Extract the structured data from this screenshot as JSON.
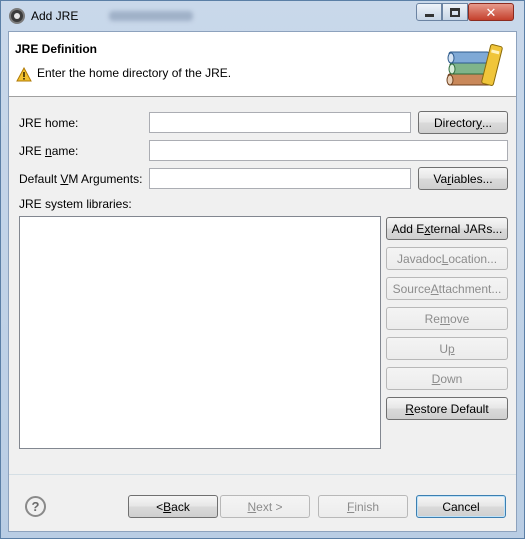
{
  "window": {
    "title": "Add JRE",
    "controls": {
      "minimize": "minimize-icon",
      "maximize": "maximize-icon",
      "close": "close-icon"
    }
  },
  "header": {
    "title": "JRE Definition",
    "message": "Enter the home directory of the JRE.",
    "message_icon": "warning-icon",
    "image": "jre-books-icon"
  },
  "form": {
    "jre_home": {
      "label_pre": "JRE home:",
      "value": ""
    },
    "jre_name": {
      "label_pre": "JRE ",
      "label_u": "n",
      "label_post": "ame:",
      "value": ""
    },
    "vm_args": {
      "label_pre": "Default ",
      "label_u": "V",
      "label_post": "M Arguments:",
      "value": ""
    },
    "directory_button": {
      "pre": "Director",
      "u": "y",
      "post": "..."
    },
    "variables_button": {
      "pre": "Va",
      "u": "r",
      "post": "iables..."
    },
    "libraries_label": "JRE system libraries:"
  },
  "side_buttons": {
    "add_external_jars": {
      "pre": "Add E",
      "u": "x",
      "post": "ternal JARs..."
    },
    "javadoc_location": {
      "pre": "Javadoc ",
      "u": "L",
      "post": "ocation..."
    },
    "source_attachment": {
      "pre": "Source ",
      "u": "A",
      "post": "ttachment..."
    },
    "remove": {
      "pre": "Re",
      "u": "m",
      "post": "ove"
    },
    "up": {
      "pre": "U",
      "u": "p",
      "post": ""
    },
    "down": {
      "pre": "",
      "u": "D",
      "post": "own"
    },
    "restore_default": {
      "pre": "",
      "u": "R",
      "post": "estore Default"
    }
  },
  "footer": {
    "help_icon": "help-icon",
    "back": {
      "pre": "< ",
      "u": "B",
      "post": "ack"
    },
    "next": {
      "pre": "",
      "u": "N",
      "post": "ext >"
    },
    "finish": {
      "pre": "",
      "u": "F",
      "post": "inish"
    },
    "cancel": "Cancel"
  },
  "colors": {
    "window_frame": "#b9cde4",
    "dialog_bg": "#f0f0f0",
    "close_button": "#c4402c",
    "disabled_text": "#8c8c8c"
  }
}
